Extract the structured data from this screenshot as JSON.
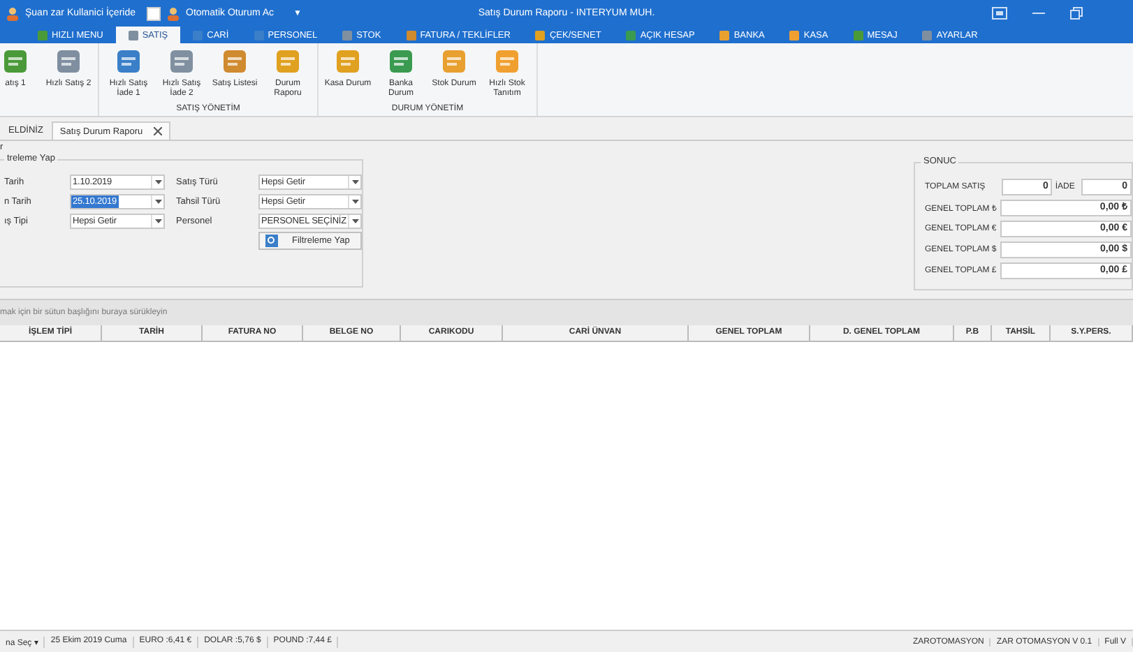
{
  "title_bar": {
    "user_status": "Şuan zar Kullanici İçeride",
    "auto_login": {
      "label": "Otomatik Oturum Ac",
      "checked": false
    },
    "dropdown": "▼",
    "title": "Satış Durum Raporu - INTERYUM MUH."
  },
  "ribbon_tabs": [
    {
      "label": "HIZLI MENU",
      "selected": false
    },
    {
      "label": "SATIŞ",
      "selected": true
    },
    {
      "label": "CARİ",
      "selected": false
    },
    {
      "label": "PERSONEL",
      "selected": false
    },
    {
      "label": "STOK",
      "selected": false
    },
    {
      "label": "FATURA / TEKLİFLER",
      "selected": false
    },
    {
      "label": "ÇEK/SENET",
      "selected": false
    },
    {
      "label": "AÇIK HESAP",
      "selected": false
    },
    {
      "label": "BANKA",
      "selected": false
    },
    {
      "label": "KASA",
      "selected": false
    },
    {
      "label": "MESAJ",
      "selected": false
    },
    {
      "label": "AYARLAR",
      "selected": false
    }
  ],
  "ribbon_groups": [
    {
      "buttons": [
        "atış 1",
        "Hızlı Satış 2"
      ]
    },
    {
      "label": "SATIŞ YÖNETİM",
      "buttons": [
        "Hızlı Satış İade 1",
        "Hızlı Satış İade 2",
        "Satış Listesi",
        "Durum Raporu"
      ]
    },
    {
      "label": "DURUM YÖNETİM",
      "buttons": [
        "Kasa Durum",
        "Banka Durum",
        "Stok Durum",
        "Hızlı Stok Tanıtım"
      ]
    }
  ],
  "doc_tabs": [
    {
      "label": "ELDİNİZ",
      "selected": false,
      "closable": false
    },
    {
      "label": "Satış Durum Raporu",
      "selected": true,
      "closable": true
    }
  ],
  "outer_group": "r",
  "filter": {
    "title": "treleme Yap",
    "left_fields": [
      {
        "label": "Tarih",
        "value": "1.10.2019",
        "highlighted": false
      },
      {
        "label": "n Tarih",
        "value": "25.10.2019",
        "highlighted": true
      },
      {
        "label": "ış Tipi",
        "value": "Hepsi Getir",
        "highlighted": false
      }
    ],
    "right_fields": [
      {
        "label": "Satış Türü",
        "value": "Hepsi Getir"
      },
      {
        "label": "Tahsil Türü",
        "value": "Hepsi Getir"
      },
      {
        "label": "Personel",
        "value": "PERSONEL SEÇİNİZ"
      }
    ],
    "button": "Filtreleme Yap"
  },
  "result": {
    "title": "SONUC",
    "total_label": "TOPLAM SATIŞ",
    "total_value": "0",
    "return_label": "İADE",
    "return_value": "0",
    "rows": [
      {
        "label": "GENEL TOPLAM ₺",
        "value": "0,00 ₺"
      },
      {
        "label": "GENEL TOPLAM €",
        "value": "0,00 €"
      },
      {
        "label": "GENEL TOPLAM $",
        "value": "0,00 $"
      },
      {
        "label": "GENEL TOPLAM £",
        "value": "0,00 £"
      }
    ]
  },
  "group_hint": "mak için bir sütun başlığını buraya sürükleyin",
  "table": {
    "columns": [
      "İŞLEM TİPİ",
      "TARİH",
      "FATURA NO",
      "BELGE NO",
      "CARIKODU",
      "CARİ ÜNVAN",
      "GENEL TOPLAM",
      "D. GENEL TOPLAM",
      "P.B",
      "TAHSİL",
      "S.Y.PERS."
    ]
  },
  "status_bar": {
    "left": [
      "na Seç ▾",
      "25 Ekim 2019 Cuma",
      "EURO :6,41 €",
      "DOLAR :5,76 $",
      "POUND :7,44 £"
    ],
    "right": [
      "ZAROTOMASYON",
      "ZAR OTOMASYON V 0.1",
      "Full V"
    ]
  }
}
